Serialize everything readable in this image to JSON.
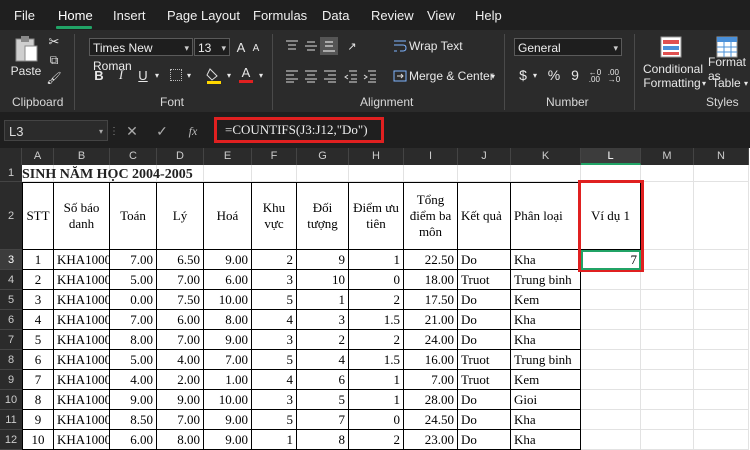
{
  "menu": {
    "tabs": [
      "File",
      "Home",
      "Insert",
      "Page Layout",
      "Formulas",
      "Data",
      "Review",
      "View",
      "Help"
    ],
    "active": "Home"
  },
  "ribbon": {
    "clipboard": {
      "paste": "Paste",
      "label": "Clipboard"
    },
    "font": {
      "name": "Times New Roman",
      "size": "13",
      "bold": "B",
      "italic": "I",
      "underline": "U",
      "grow": "A",
      "shrink": "A",
      "font_color_letter": "A",
      "label": "Font"
    },
    "alignment": {
      "wrap_text": "Wrap Text",
      "merge_center": "Merge & Center",
      "label": "Alignment"
    },
    "number": {
      "format": "General",
      "currency": "$",
      "percent": "%",
      "comma": "9",
      "label": "Number"
    },
    "styles": {
      "conditional": "Conditional",
      "formatting": "Formatting",
      "format_as": "Format as",
      "table": "Table",
      "label": "Styles"
    }
  },
  "formula_bar": {
    "name_box": "L3",
    "formula": "=COUNTIFS(J3:J12,\"Do\")"
  },
  "columns": [
    "A",
    "B",
    "C",
    "D",
    "E",
    "F",
    "G",
    "H",
    "I",
    "J",
    "K",
    "L",
    "M",
    "N"
  ],
  "selected_column": "L",
  "rows": [
    "1",
    "2",
    "3",
    "4",
    "5",
    "6",
    "7",
    "8",
    "9",
    "10",
    "11",
    "12"
  ],
  "selected_row": "3",
  "sheet": {
    "title": "SINH NĂM HỌC 2004-2005",
    "headers": {
      "stt": "STT",
      "so_bao_danh": "Số báo danh",
      "toan": "Toán",
      "ly": "Lý",
      "hoa": "Hoá",
      "khu_vuc": "Khu vực",
      "doi_tuong": "Đối tượng",
      "diem_uu_tien": "Điểm ưu tiên",
      "tong_diem": "Tổng điểm ba môn",
      "ket_qua": "Kết quả",
      "phan_loai": "Phân loại",
      "vi_du": "Ví dụ 1"
    },
    "data_rows": [
      [
        "1",
        "KHA1000",
        "7.00",
        "6.50",
        "9.00",
        "2",
        "9",
        "1",
        "22.50",
        "Do",
        "Kha"
      ],
      [
        "2",
        "KHA1000",
        "5.00",
        "7.00",
        "6.00",
        "3",
        "10",
        "0",
        "18.00",
        "Truot",
        "Trung binh"
      ],
      [
        "3",
        "KHA1000",
        "0.00",
        "7.50",
        "10.00",
        "5",
        "1",
        "2",
        "17.50",
        "Do",
        "Kem"
      ],
      [
        "4",
        "KHA1000",
        "7.00",
        "6.00",
        "8.00",
        "4",
        "3",
        "1.5",
        "21.00",
        "Do",
        "Kha"
      ],
      [
        "5",
        "KHA1000",
        "8.00",
        "7.00",
        "9.00",
        "3",
        "2",
        "2",
        "24.00",
        "Do",
        "Kha"
      ],
      [
        "6",
        "KHA1000",
        "5.00",
        "4.00",
        "7.00",
        "5",
        "4",
        "1.5",
        "16.00",
        "Truot",
        "Trung binh"
      ],
      [
        "7",
        "KHA1000",
        "4.00",
        "2.00",
        "1.00",
        "4",
        "6",
        "1",
        "7.00",
        "Truot",
        "Kem"
      ],
      [
        "8",
        "KHA1000",
        "9.00",
        "9.00",
        "10.00",
        "3",
        "5",
        "1",
        "28.00",
        "Do",
        "Gioi"
      ],
      [
        "9",
        "KHA1000",
        "8.50",
        "7.00",
        "9.00",
        "5",
        "7",
        "0",
        "24.50",
        "Do",
        "Kha"
      ],
      [
        "10",
        "KHA1000",
        "6.00",
        "8.00",
        "9.00",
        "1",
        "8",
        "2",
        "23.00",
        "Do",
        "Kha"
      ]
    ],
    "result_value": "7"
  },
  "colors": {
    "highlight": "#e02020",
    "accent": "#21a366"
  }
}
